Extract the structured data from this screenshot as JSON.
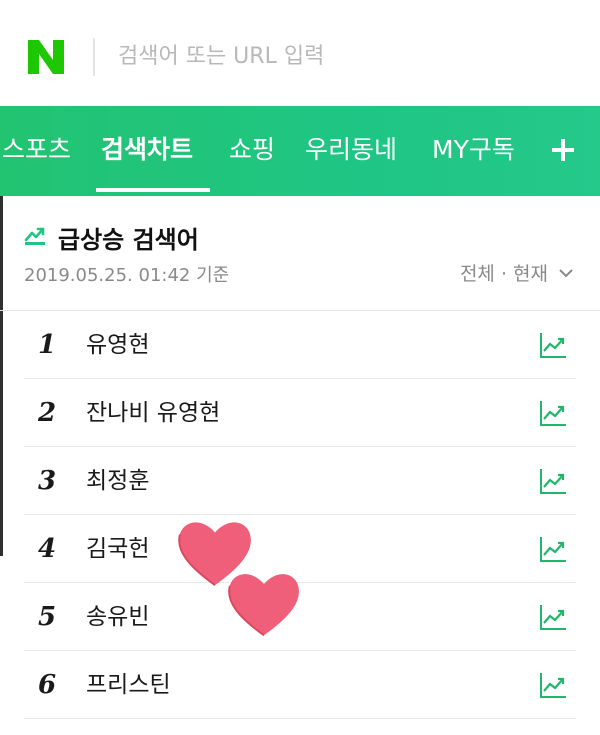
{
  "search": {
    "logo_letter": "N",
    "placeholder": "검색어 또는 URL 입력"
  },
  "tabs": [
    {
      "label": "스포츠",
      "active": false
    },
    {
      "label": "검색차트",
      "active": true
    },
    {
      "label": "쇼핑",
      "active": false
    },
    {
      "label": "우리동네",
      "active": false
    },
    {
      "label": "MY구독",
      "active": false
    }
  ],
  "add_tab_icon": "plus-icon",
  "section": {
    "icon": "rising-chart-icon",
    "title": "급상승 검색어",
    "date": "2019.05.25. 01:42 기준",
    "filter_label": "전체 · 현재",
    "filter_icon": "chevron-down-icon"
  },
  "rankings": [
    {
      "rank": "1",
      "keyword": "유영현"
    },
    {
      "rank": "2",
      "keyword": "잔나비 유영현"
    },
    {
      "rank": "3",
      "keyword": "최정훈"
    },
    {
      "rank": "4",
      "keyword": "김국헌"
    },
    {
      "rank": "5",
      "keyword": "송유빈"
    },
    {
      "rank": "6",
      "keyword": "프리스틴"
    }
  ],
  "decorations": [
    "heart-sticker",
    "heart-sticker"
  ],
  "colors": {
    "brand_green": "#1fc584",
    "trend_green": "#1fb86b",
    "heart_pink": "#ef5f7a"
  }
}
